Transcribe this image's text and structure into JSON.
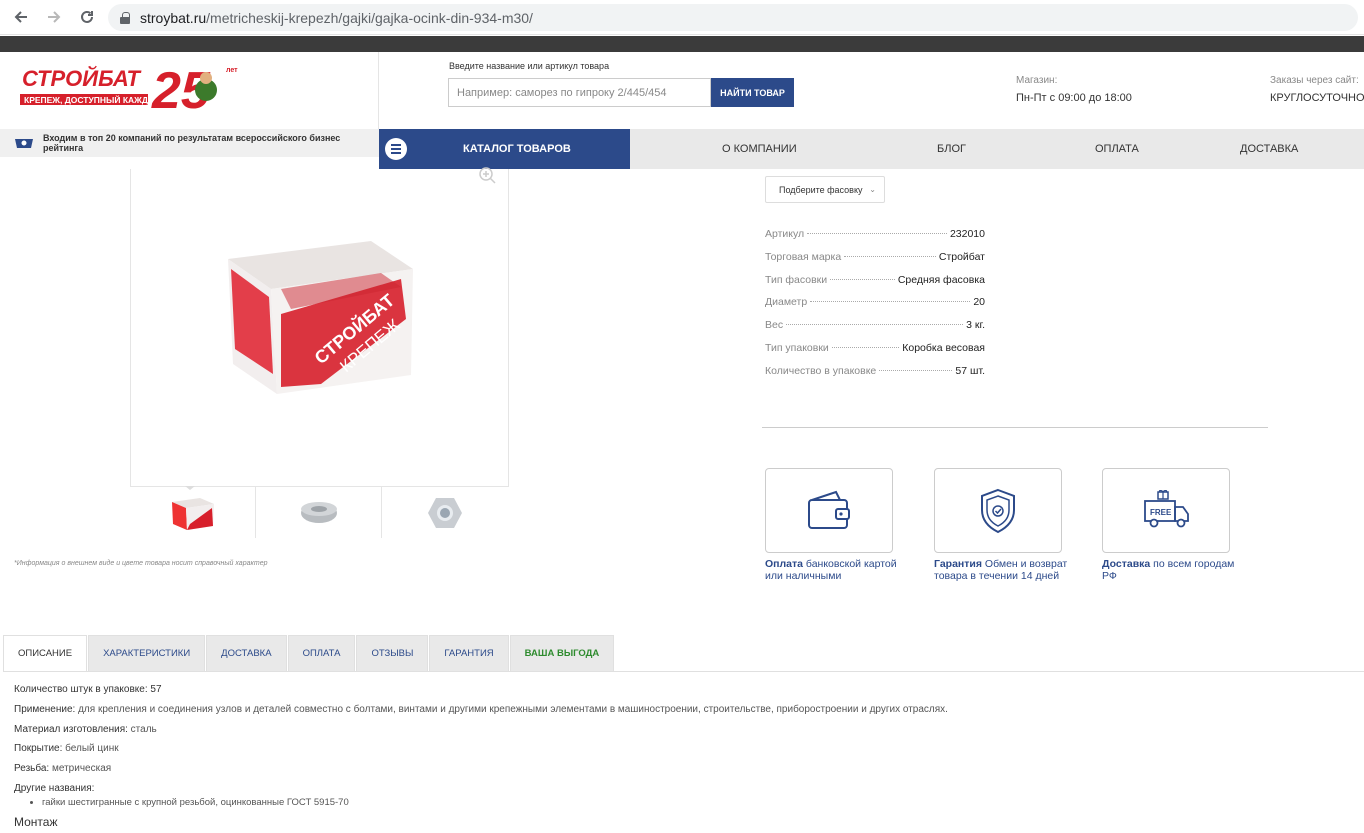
{
  "browser": {
    "url_domain": "stroybat.ru",
    "url_path": "/metricheskij-krepezh/gajki/gajka-ocink-din-934-m30/"
  },
  "header": {
    "logo_text": "СТРОЙБАТ",
    "logo_tagline": "КРЕПЕЖ, ДОСТУПНЫЙ КАЖДОМУ!",
    "logo_years": "25",
    "logo_years_suffix": "лет",
    "search_label": "Введите название или артикул товара",
    "search_placeholder": "Например: саморез по гипроку 2/445/454",
    "search_button": "НАЙТИ ТОВАР",
    "shop_label": "Магазин:",
    "shop_hours": "Пн-Пт с 09:00 до 18:00",
    "orders_label": "Заказы через сайт:",
    "orders_value": "КРУГЛОСУТОЧНО"
  },
  "rating_text": "Входим в топ 20 компаний по результатам всероссийского бизнес рейтинга",
  "nav": {
    "catalog": "КАТАЛОГ ТОВАРОВ",
    "links": [
      "О КОМПАНИИ",
      "БЛОГ",
      "ОПЛАТА",
      "ДОСТАВКА"
    ]
  },
  "gallery": {
    "box_brand": "СТРОЙБАТ",
    "box_word": "КРЕПЕЖ",
    "disclaimer": "*Информация о внешнем виде и цвете товара носит справочный характер"
  },
  "product": {
    "pack_select": "Подберите фасовку",
    "specs": [
      {
        "key": "Артикул",
        "value": "232010"
      },
      {
        "key": "Торговая марка",
        "value": "Стройбат"
      },
      {
        "key": "Тип фасовки",
        "value": "Средняя фасовка"
      },
      {
        "key": "Диаметр",
        "value": "20"
      },
      {
        "key": "Вес",
        "value": "3 кг."
      },
      {
        "key": "Тип упаковки",
        "value": "Коробка весовая"
      },
      {
        "key": "Количество в упаковке",
        "value": "57 шт."
      }
    ]
  },
  "features": [
    {
      "title": "Оплата",
      "text": " банковской картой или наличными",
      "icon": "wallet-icon"
    },
    {
      "title": "Гарантия",
      "text": " Обмен и возврат товара в течении 14 дней",
      "icon": "shield-icon"
    },
    {
      "title": "Доставка",
      "text": " по всем городам РФ",
      "icon": "truck-icon",
      "badge": "FREE"
    }
  ],
  "tabs": [
    "ОПИСАНИЕ",
    "ХАРАКТЕРИСТИКИ",
    "ДОСТАВКА",
    "ОПЛАТА",
    "ОТЗЫВЫ",
    "ГАРАНТИЯ",
    "ВАША ВЫГОДА"
  ],
  "description": {
    "qty_label": "Количество штук в упаковке:",
    "qty_value": " 57",
    "use_label": "Применение:",
    "use_value": " для крепления и соединения узлов и деталей совместно с болтами, винтами и другими крепежными элементами в машиностроении, строительстве, приборостроении и других отраслях.",
    "material_label": "Материал изготовления:",
    "material_value": " сталь",
    "coating_label": "Покрытие:",
    "coating_value": " белый цинк",
    "thread_label": "Резьба:",
    "thread_value": " метрическая",
    "other_names_label": "Другие названия:",
    "other_names": [
      "гайки шестигранные с крупной резьбой, оцинкованные ГОСТ 5915-70"
    ],
    "mount_heading": "Монтаж"
  },
  "colors": {
    "brand_blue": "#2c4a8a",
    "brand_red": "#d6202b",
    "green_tab": "#2e8b2e"
  }
}
